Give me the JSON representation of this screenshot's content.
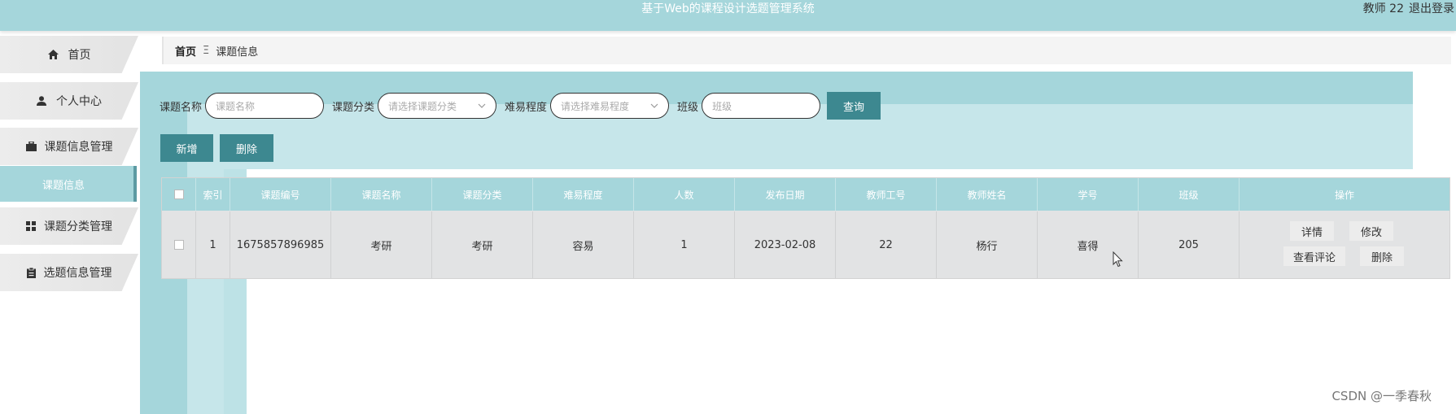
{
  "header": {
    "title": "基于Web的课程设计选题管理系统",
    "user": "教师 22",
    "logout": "退出登录"
  },
  "sidebar": {
    "items": [
      {
        "label": "首页",
        "icon": "home-icon"
      },
      {
        "label": "个人中心",
        "icon": "user-icon"
      },
      {
        "label": "课题信息管理",
        "icon": "briefcase-icon"
      },
      {
        "label": "课题分类管理",
        "icon": "grid-icon"
      },
      {
        "label": "选题信息管理",
        "icon": "clipboard-icon"
      }
    ],
    "subitem": "课题信息"
  },
  "breadcrumb": {
    "home": "首页",
    "separator": "Ξ",
    "current": "课题信息"
  },
  "search": {
    "name_label": "课题名称",
    "name_placeholder": "课题名称",
    "category_label": "课题分类",
    "category_placeholder": "请选择课题分类",
    "difficulty_label": "难易程度",
    "difficulty_placeholder": "请选择难易程度",
    "class_label": "班级",
    "class_placeholder": "班级",
    "button": "查询"
  },
  "actions": {
    "add": "新增",
    "delete": "删除"
  },
  "table": {
    "headers": [
      "索引",
      "课题编号",
      "课题名称",
      "课题分类",
      "难易程度",
      "人数",
      "发布日期",
      "教师工号",
      "教师姓名",
      "学号",
      "班级",
      "操作"
    ],
    "row": [
      "1",
      "1675857896985",
      "考研",
      "考研",
      "容易",
      "1",
      "2023-02-08",
      "22",
      "杨行",
      "喜得",
      "205"
    ],
    "ops": {
      "detail": "详情",
      "edit": "修改",
      "comments": "查看评论",
      "delete": "删除"
    }
  },
  "watermark": "CSDN @一季春秋"
}
